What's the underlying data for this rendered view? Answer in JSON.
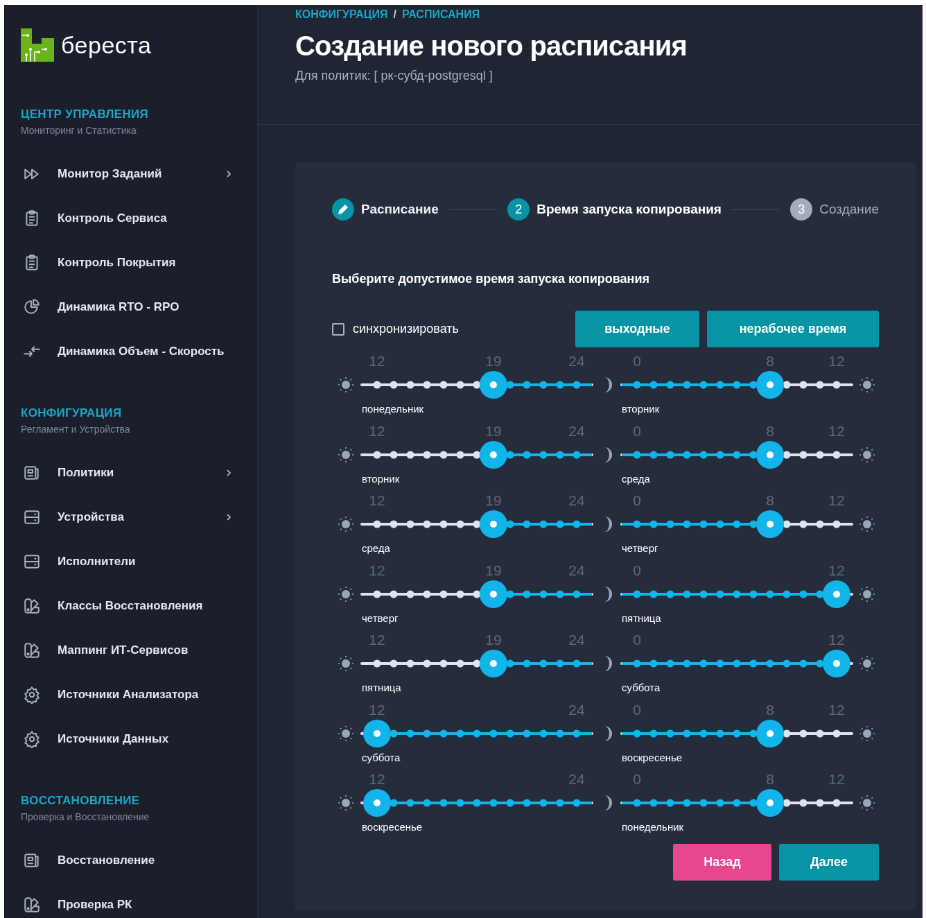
{
  "logo": {
    "text": "береста"
  },
  "sidebar": {
    "sections": [
      {
        "title": "ЦЕНТР УПРАВЛЕНИЯ",
        "subtitle": "Мониторинг и Статистика",
        "items": [
          {
            "label": "Монитор Заданий",
            "kind": "forward",
            "expandable": true
          },
          {
            "label": "Контроль Сервиса",
            "kind": "clipboard",
            "expandable": false
          },
          {
            "label": "Контроль Покрытия",
            "kind": "clipboard",
            "expandable": false
          },
          {
            "label": "Динамика RTO - RPO",
            "kind": "pie",
            "expandable": false
          },
          {
            "label": "Динамика Объем - Скорость",
            "kind": "arrows",
            "expandable": false
          }
        ]
      },
      {
        "title": "КОНФИГУРАЦИЯ",
        "subtitle": "Регламент и Устройства",
        "items": [
          {
            "label": "Политики",
            "kind": "document",
            "expandable": true
          },
          {
            "label": "Устройства",
            "kind": "server",
            "expandable": true
          },
          {
            "label": "Исполнители",
            "kind": "server",
            "expandable": false
          },
          {
            "label": "Классы Восстановления",
            "kind": "palette",
            "expandable": false
          },
          {
            "label": "Маппинг ИТ-Сервисов",
            "kind": "palette",
            "expandable": false
          },
          {
            "label": "Источники Анализатора",
            "kind": "gear",
            "expandable": false
          },
          {
            "label": "Источники Данных",
            "kind": "gear",
            "expandable": false
          }
        ]
      },
      {
        "title": "ВОССТАНОВЛЕНИЕ",
        "subtitle": "Проверка и Восстановление",
        "items": [
          {
            "label": "Восстановление",
            "kind": "document",
            "expandable": false
          },
          {
            "label": "Проверка РК",
            "kind": "palette",
            "expandable": false
          }
        ]
      }
    ]
  },
  "breadcrumb": {
    "items": [
      "КОНФИГУРАЦИЯ",
      "РАСПИСАНИЯ"
    ],
    "separator": "/"
  },
  "title": "Создание нового расписания",
  "subtitle": "Для политик: [ рк-субд-postgresql ]",
  "steps": [
    {
      "label": "Расписание",
      "done": true,
      "selected": false
    },
    {
      "number": "2",
      "label": "Время запуска копирования",
      "done": false,
      "selected": true
    },
    {
      "number": "3",
      "label": "Создание",
      "done": false,
      "selected": false
    }
  ],
  "prompt": "Выберите допустимое время запуска копирования",
  "sync": {
    "label": "синхронизировать",
    "checked": false
  },
  "presets": [
    "выходные",
    "нерабочее время"
  ],
  "rows": [
    {
      "left": {
        "kind": "evening",
        "from": "12",
        "value": "19",
        "to": "24",
        "level": 0.583,
        "day": "понедельник"
      },
      "right": {
        "kind": "morning",
        "from": "0",
        "value": "8",
        "to": "12",
        "level": 0.667,
        "day": "вторник"
      }
    },
    {
      "left": {
        "kind": "evening",
        "from": "12",
        "value": "19",
        "to": "24",
        "level": 0.583,
        "day": "вторник"
      },
      "right": {
        "kind": "morning",
        "from": "0",
        "value": "8",
        "to": "12",
        "level": 0.667,
        "day": "среда"
      }
    },
    {
      "left": {
        "kind": "evening",
        "from": "12",
        "value": "19",
        "to": "24",
        "level": 0.583,
        "day": "среда"
      },
      "right": {
        "kind": "morning",
        "from": "0",
        "value": "8",
        "to": "12",
        "level": 0.667,
        "day": "четверг"
      }
    },
    {
      "left": {
        "kind": "evening",
        "from": "12",
        "value": "19",
        "to": "24",
        "level": 0.583,
        "day": "четверг"
      },
      "right": {
        "kind": "morning",
        "from": "0",
        "to": "12",
        "level": 1,
        "day": "пятница"
      }
    },
    {
      "left": {
        "kind": "evening",
        "from": "12",
        "value": "19",
        "to": "24",
        "level": 0.583,
        "day": "пятница"
      },
      "right": {
        "kind": "morning",
        "from": "0",
        "to": "12",
        "level": 1,
        "day": "суббота"
      }
    },
    {
      "left": {
        "kind": "evening",
        "from": "12",
        "to": "24",
        "level": 0,
        "day": "суббота"
      },
      "right": {
        "kind": "morning",
        "from": "0",
        "value": "8",
        "to": "12",
        "level": 0.667,
        "day": "воскресенье"
      }
    },
    {
      "left": {
        "kind": "evening",
        "from": "12",
        "to": "24",
        "level": 0,
        "day": "воскресенье"
      },
      "right": {
        "kind": "morning",
        "from": "0",
        "value": "8",
        "to": "12",
        "level": 0.667,
        "day": "понедельник"
      }
    }
  ],
  "actions": {
    "back": "Назад",
    "next": "Далее"
  }
}
